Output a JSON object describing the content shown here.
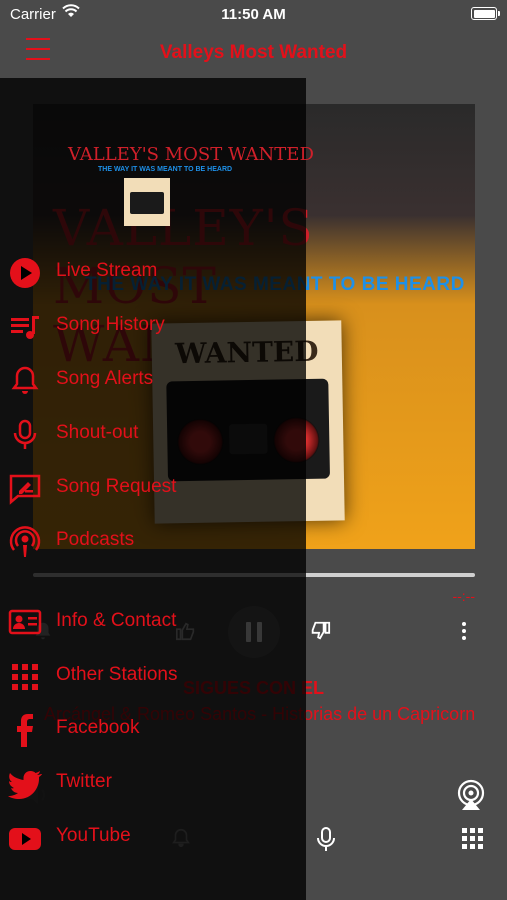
{
  "status_bar": {
    "carrier": "Carrier",
    "time": "11:50 AM"
  },
  "header": {
    "title": "Valleys Most Wanted",
    "menu_icon": "hamburger-icon"
  },
  "artwork": {
    "title": "VALLEY'S MOST WANTED",
    "tagline": "THE WAY IT WAS MEANT TO BE HEARD",
    "poster": "WANTED"
  },
  "player": {
    "time_remaining": "--:--",
    "progress": 0,
    "track_title": "SIGUES CON EL",
    "track_artist": "Arcángel & Romeo Santos - Historias de un Capricornio"
  },
  "drawer": {
    "items": [
      {
        "label": "Live Stream",
        "icon": "play-circle-icon"
      },
      {
        "label": "Song History",
        "icon": "song-history-icon"
      },
      {
        "label": "Song Alerts",
        "icon": "bell-icon"
      },
      {
        "label": "Shout-out",
        "icon": "microphone-icon"
      },
      {
        "label": "Song Request",
        "icon": "song-request-icon"
      },
      {
        "label": "Podcasts",
        "icon": "podcast-icon"
      },
      {
        "label": "Info & Contact",
        "icon": "contact-card-icon"
      },
      {
        "label": "Other Stations",
        "icon": "grid-icon"
      },
      {
        "label": "Facebook",
        "icon": "facebook-icon"
      },
      {
        "label": "Twitter",
        "icon": "twitter-icon"
      },
      {
        "label": "YouTube",
        "icon": "youtube-icon"
      }
    ]
  },
  "colors": {
    "accent": "#e3101a",
    "background": "#4a4a4a",
    "drawer": "#000000"
  }
}
